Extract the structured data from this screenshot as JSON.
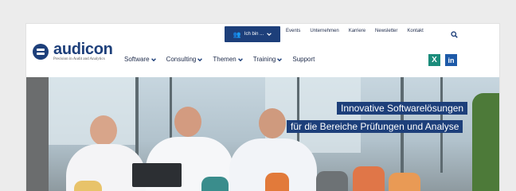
{
  "logo": {
    "name": "audicon",
    "tagline": "Precision in Audit and Analytics"
  },
  "topbar": {
    "cta_label": "Ich bin ...",
    "links": [
      "Events",
      "Unternehmen",
      "Karriere",
      "Newsletter",
      "Kontakt"
    ]
  },
  "mainnav": {
    "items": [
      {
        "label": "Software",
        "dropdown": true
      },
      {
        "label": "Consulting",
        "dropdown": true
      },
      {
        "label": "Themen",
        "dropdown": true
      },
      {
        "label": "Training",
        "dropdown": true
      },
      {
        "label": "Support",
        "dropdown": false
      }
    ]
  },
  "social": {
    "xing": "X",
    "linkedin": "in"
  },
  "hero": {
    "line1": "Innovative Softwarelösungen",
    "line2": "für die Bereiche Prüfungen und Analyse"
  },
  "colors": {
    "brand": "#1d3f7a",
    "xing": "#1b8c7b",
    "linkedin": "#1d5aa8"
  },
  "icons": [
    "people-icon",
    "chevron-down-icon",
    "search-icon",
    "xing-icon",
    "linkedin-icon"
  ]
}
